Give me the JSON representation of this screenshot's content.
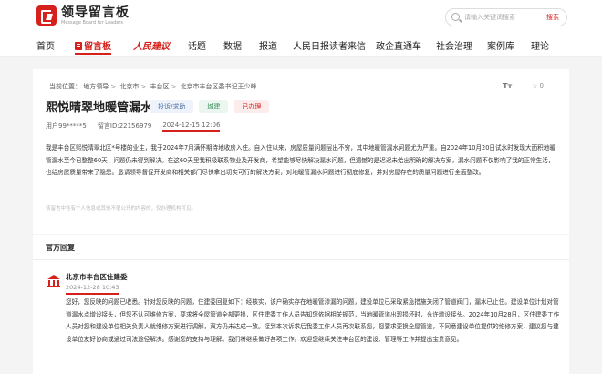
{
  "brand": {
    "name_cn": "领导留言板",
    "name_en": "Message Board for Leaders",
    "accent": "#d6201b"
  },
  "search": {
    "placeholder": "请输入关键词搜索",
    "button": "搜索"
  },
  "nav": [
    {
      "label": "首页"
    },
    {
      "label": "留言板",
      "active": true
    },
    {
      "label": "人民建议"
    },
    {
      "label": "话题"
    },
    {
      "label": "数据"
    },
    {
      "label": "报道"
    },
    {
      "label": "人民日报读者来信"
    },
    {
      "label": "政企直通车"
    },
    {
      "label": "社会治理"
    },
    {
      "label": "案例库"
    },
    {
      "label": "理论"
    }
  ],
  "message": {
    "breadcrumb_prefix": "当前位置：",
    "breadcrumb": [
      "地方领导",
      "北京市",
      "丰台区",
      "北京市丰台区委书记王少峰"
    ],
    "font_tool": "Tт",
    "fav_count": "0",
    "title": "熙悦晴翠地暖管漏水",
    "tags": [
      "投诉/求助",
      "城建",
      "已办理"
    ],
    "user": "用户99*****5",
    "id": "留言ID:22156979",
    "date": "2024-12-15 12:06",
    "content": "我是丰台区熙悦晴翠北区*号楼的业主，我于2024年7月满怀期待地收房入住。自入住以来，房屋质量问题层出不穷，其中地暖管漏水问题尤为严重。自2024年10月20日试水时发现大面积地暖管漏水至今已整整60天，问题仍未得到解决。在这60天里我积极联系物业及开发商，希望能够尽快解决漏水问题，但遗憾的是迟迟未给出明确的解决方案，漏水问题不仅影响了我的正常生活，也给房屋质量带来了隐患。恳请领导督促开发商和相关部门尽快拿出切实可行的解决方案，对地暖管漏水问题进行彻底修复，并对房屋存在的质量问题进行全面整改。",
    "note": "该留言中含有个人信息或其他不便公开的内容的，仅办理机构可见。"
  },
  "reply": {
    "heading": "官方回复",
    "org": "北京市丰台区住建委",
    "date": "2024-12-28 10:43",
    "text": "您好，您反映的问题已收悉。针对您反映的问题，住建委回复如下：经核实，该户确实存在地暖管渗漏的问题，建设单位已采取紧急措施关闭了管道阀门，漏水已止住。建设单位计划对管道漏水点增设接头，但您不认可维修方案，要求将全屋管道全部更换，区住建委工作人员告知您依据相关规范，当地暖管道出现损坏时，允许增设接头。2024年10月28日，区住建委工作人员对您和建设单位相关负责人就维修方案进行调解，双方仍未达成一致。接到本次诉求后我委工作人员再次联系您，您要求更换全屋管道，不同意建设单位提供的维修方案，建议您与建设单位友好协商或通过司法途径解决。感谢您的支持与理解。我们将继续做好各项工作。欢迎您继续关注丰台区的建设、管理等工作并提出宝贵意见。"
  }
}
